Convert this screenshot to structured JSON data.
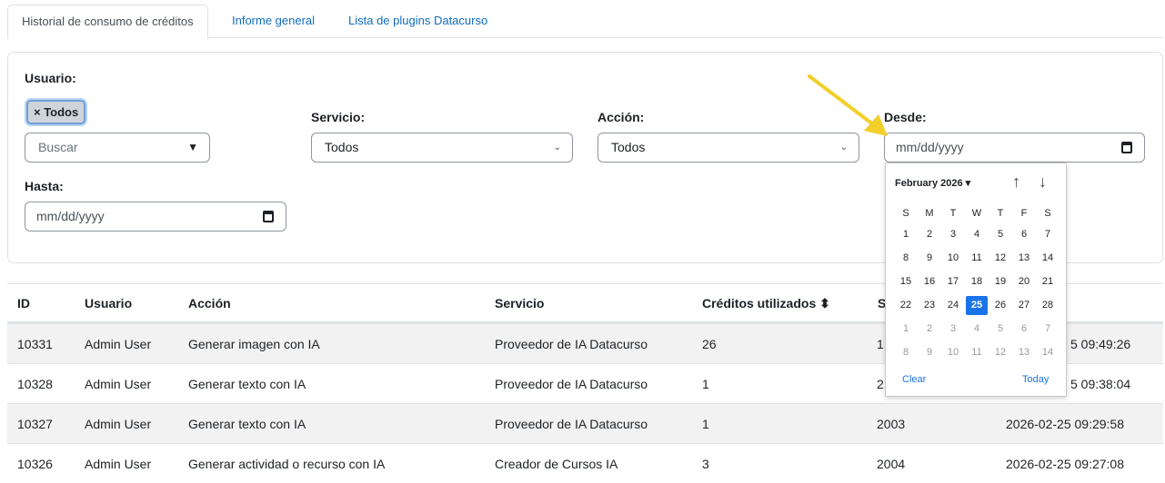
{
  "tabs": [
    "Historial de consumo de créditos",
    "Informe general",
    "Lista de plugins Datacurso"
  ],
  "filters": {
    "usuario_label": "Usuario:",
    "chip": "× Todos",
    "buscar_placeholder": "Buscar",
    "servicio_label": "Servicio:",
    "servicio_value": "Todos",
    "accion_label": "Acción:",
    "accion_value": "Todos",
    "desde_label": "Desde:",
    "desde_value": "mm/dd/yyyy",
    "hasta_label": "Hasta:",
    "hasta_value": "mm/dd/yyyy"
  },
  "table": {
    "headers": [
      "ID",
      "Usuario",
      "Acción",
      "Servicio",
      "Créditos utilizados ⬍",
      "S"
    ],
    "rows": [
      [
        "10331",
        "Admin User",
        "Generar imagen con IA",
        "Proveedor de IA Datacurso",
        "26",
        "1",
        "5 09:49:26"
      ],
      [
        "10328",
        "Admin User",
        "Generar texto con IA",
        "Proveedor de IA Datacurso",
        "1",
        "2",
        "5 09:38:04"
      ],
      [
        "10327",
        "Admin User",
        "Generar texto con IA",
        "Proveedor de IA Datacurso",
        "1",
        "2003",
        "2026-02-25 09:29:58"
      ],
      [
        "10326",
        "Admin User",
        "Generar actividad o recurso con IA",
        "Creador de Cursos IA",
        "3",
        "2004",
        "2026-02-25 09:27:08"
      ]
    ]
  },
  "calendar": {
    "month": "February 2026 ▾",
    "up": "↑",
    "down": "↓",
    "weekdays": [
      "S",
      "M",
      "T",
      "W",
      "T",
      "F",
      "S"
    ],
    "weeks": [
      [
        "1",
        "2",
        "3",
        "4",
        "5",
        "6",
        "7"
      ],
      [
        "8",
        "9",
        "10",
        "11",
        "12",
        "13",
        "14"
      ],
      [
        "15",
        "16",
        "17",
        "18",
        "19",
        "20",
        "21"
      ],
      [
        "22",
        "23",
        "24",
        "25",
        "26",
        "27",
        "28"
      ],
      [
        "1",
        "2",
        "3",
        "4",
        "5",
        "6",
        "7"
      ],
      [
        "8",
        "9",
        "10",
        "11",
        "12",
        "13",
        "14"
      ]
    ],
    "selected": "25",
    "clear": "Clear",
    "today": "Today"
  },
  "colors": {
    "accent": "#0f6cbf",
    "selected_day": "#1a73e8",
    "arrow": "#f2cf2a"
  }
}
